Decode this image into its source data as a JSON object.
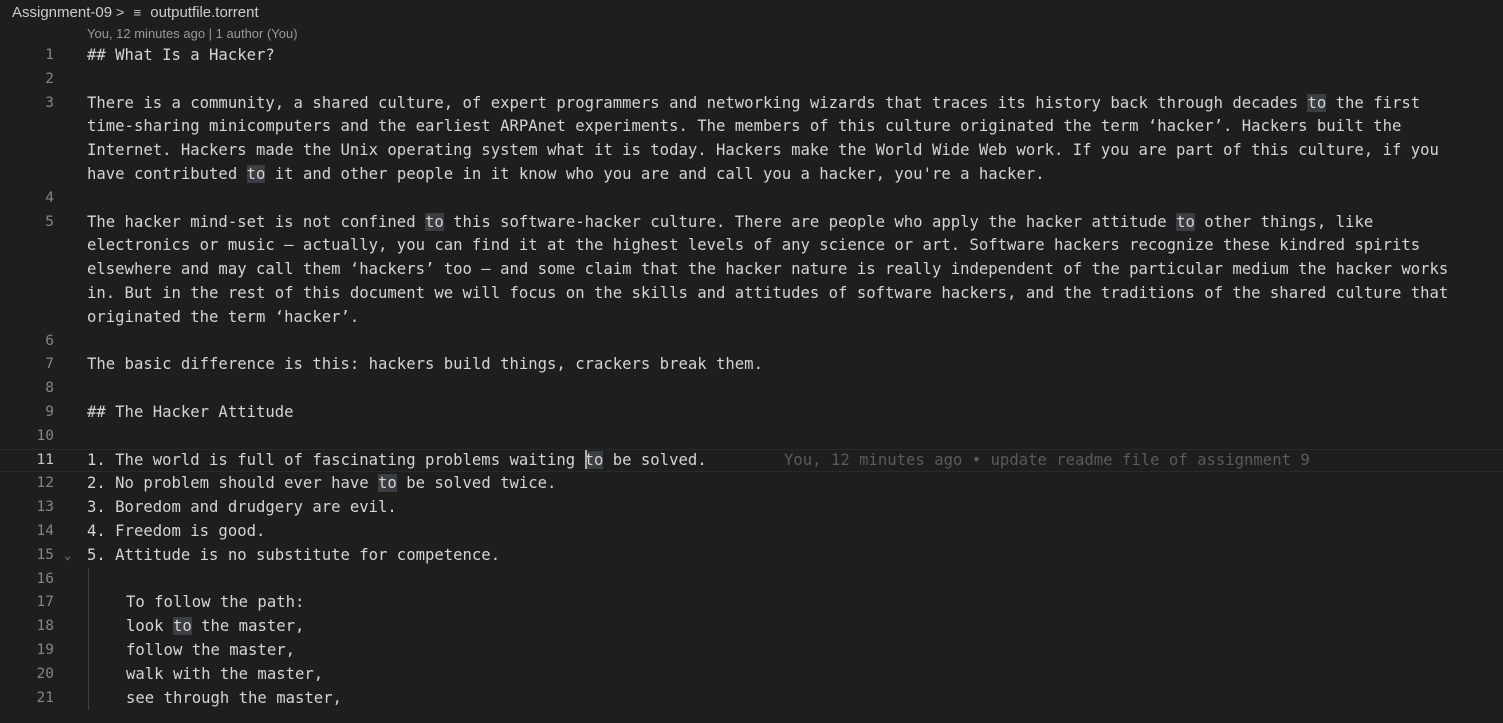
{
  "breadcrumb": {
    "folder": "Assignment-09",
    "separator": ">",
    "file": "outputfile.torrent"
  },
  "codelens": "You, 12 minutes ago | 1 author (You)",
  "icons": {
    "file": "lines-file-icon",
    "fold": "chevron-down-icon"
  },
  "lines": [
    {
      "n": "1",
      "segments": [
        {
          "t": "## What Is a Hacker?"
        }
      ]
    },
    {
      "n": "2",
      "segments": []
    },
    {
      "n": "3",
      "segments": [
        {
          "t": "There is a community, a shared culture, of expert programmers and networking wizards that traces its history back through decades "
        },
        {
          "t": "to",
          "hl": true
        },
        {
          "t": " the first"
        }
      ]
    },
    {
      "n": "",
      "segments": [
        {
          "t": "time-sharing minicomputers and the earliest ARPAnet experiments. The members of this culture originated the term ‘hacker’. Hackers built the"
        }
      ]
    },
    {
      "n": "",
      "segments": [
        {
          "t": "Internet. Hackers made the Unix operating system what it is today. Hackers make the World Wide Web work. If you are part of this culture, if you"
        }
      ]
    },
    {
      "n": "",
      "segments": [
        {
          "t": "have contributed "
        },
        {
          "t": "to",
          "hl": true
        },
        {
          "t": " it and other people in it know who you are and call you a hacker, you're a hacker."
        }
      ]
    },
    {
      "n": "4",
      "segments": []
    },
    {
      "n": "5",
      "segments": [
        {
          "t": "The hacker mind-set is not confined "
        },
        {
          "t": "to",
          "hl": true
        },
        {
          "t": " this software-hacker culture. There are people who apply the hacker attitude "
        },
        {
          "t": "to",
          "hl": true
        },
        {
          "t": " other things, like"
        }
      ]
    },
    {
      "n": "",
      "segments": [
        {
          "t": "electronics or music — actually, you can find it at the highest levels of any science or art. Software hackers recognize these kindred spirits"
        }
      ]
    },
    {
      "n": "",
      "segments": [
        {
          "t": "elsewhere and may call them ‘hackers’ too — and some claim that the hacker nature is really independent of the particular medium the hacker works"
        }
      ]
    },
    {
      "n": "",
      "segments": [
        {
          "t": "in. But in the rest of this document we will focus on the skills and attitudes of software hackers, and the traditions of the shared culture that"
        }
      ]
    },
    {
      "n": "",
      "segments": [
        {
          "t": "originated the term ‘hacker’."
        }
      ]
    },
    {
      "n": "6",
      "segments": []
    },
    {
      "n": "7",
      "segments": [
        {
          "t": "The basic difference is this: hackers build things, crackers break them."
        }
      ]
    },
    {
      "n": "8",
      "segments": []
    },
    {
      "n": "9",
      "segments": [
        {
          "t": "## The Hacker Attitude"
        }
      ]
    },
    {
      "n": "10",
      "segments": []
    },
    {
      "n": "11",
      "active": true,
      "segments": [
        {
          "t": "1. The world is full of fascinating problems waiting "
        },
        {
          "t": "to",
          "hl": true,
          "cursor": true
        },
        {
          "t": " be solved."
        }
      ],
      "blame": "You, 12 minutes ago • update readme file of assignment 9"
    },
    {
      "n": "12",
      "segments": [
        {
          "t": "2. No problem should ever have "
        },
        {
          "t": "to",
          "hl": true
        },
        {
          "t": " be solved twice."
        }
      ]
    },
    {
      "n": "13",
      "segments": [
        {
          "t": "3. Boredom and drudgery are evil."
        }
      ]
    },
    {
      "n": "14",
      "segments": [
        {
          "t": "4. Freedom is good."
        }
      ]
    },
    {
      "n": "15",
      "fold": true,
      "segments": [
        {
          "t": "5. Attitude is no substitute for competence."
        }
      ]
    },
    {
      "n": "16",
      "guide": true,
      "segments": []
    },
    {
      "n": "17",
      "guide": true,
      "indent": true,
      "segments": [
        {
          "t": "To follow the path:"
        }
      ]
    },
    {
      "n": "18",
      "guide": true,
      "indent": true,
      "segments": [
        {
          "t": "look "
        },
        {
          "t": "to",
          "hl": true
        },
        {
          "t": " the master,"
        }
      ]
    },
    {
      "n": "19",
      "guide": true,
      "indent": true,
      "segments": [
        {
          "t": "follow the master,"
        }
      ]
    },
    {
      "n": "20",
      "guide": true,
      "indent": true,
      "segments": [
        {
          "t": "walk with the master,"
        }
      ]
    },
    {
      "n": "21",
      "guide": true,
      "indent": true,
      "segments": [
        {
          "t": "see through the master,"
        }
      ]
    }
  ]
}
